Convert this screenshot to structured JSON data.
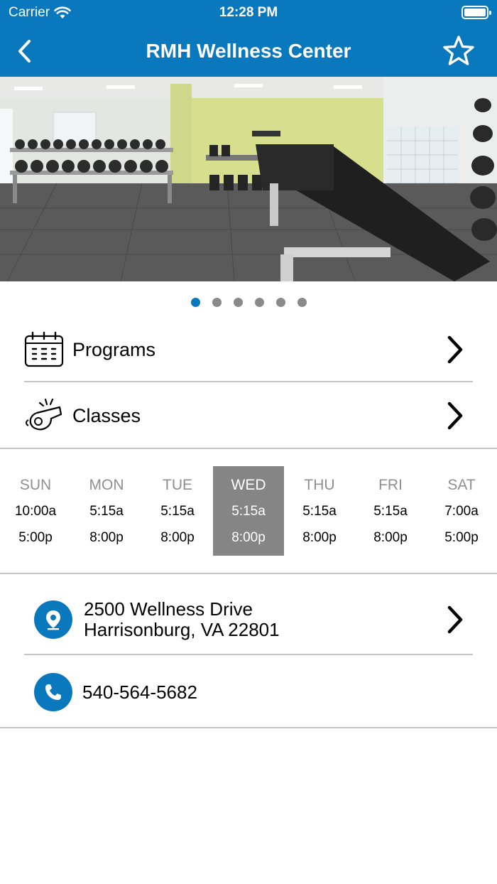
{
  "status_bar": {
    "carrier": "Carrier",
    "time": "12:28 PM"
  },
  "nav": {
    "title": "RMH Wellness Center"
  },
  "carousel": {
    "page_count": 6,
    "active_index": 0
  },
  "menu": {
    "programs_label": "Programs",
    "classes_label": "Classes"
  },
  "hours": {
    "days": [
      {
        "name": "SUN",
        "open": "10:00a",
        "close": "5:00p"
      },
      {
        "name": "MON",
        "open": "5:15a",
        "close": "8:00p"
      },
      {
        "name": "TUE",
        "open": "5:15a",
        "close": "8:00p"
      },
      {
        "name": "WED",
        "open": "5:15a",
        "close": "8:00p"
      },
      {
        "name": "THU",
        "open": "5:15a",
        "close": "8:00p"
      },
      {
        "name": "FRI",
        "open": "5:15a",
        "close": "8:00p"
      },
      {
        "name": "SAT",
        "open": "7:00a",
        "close": "5:00p"
      }
    ],
    "selected_day": "WED"
  },
  "location": {
    "address_line1": "2500 Wellness Drive",
    "address_line2": "Harrisonburg, VA 22801",
    "phone": "540-564-5682"
  },
  "colors": {
    "brand": "#0a78bd",
    "selected_day_bg": "#858585"
  }
}
